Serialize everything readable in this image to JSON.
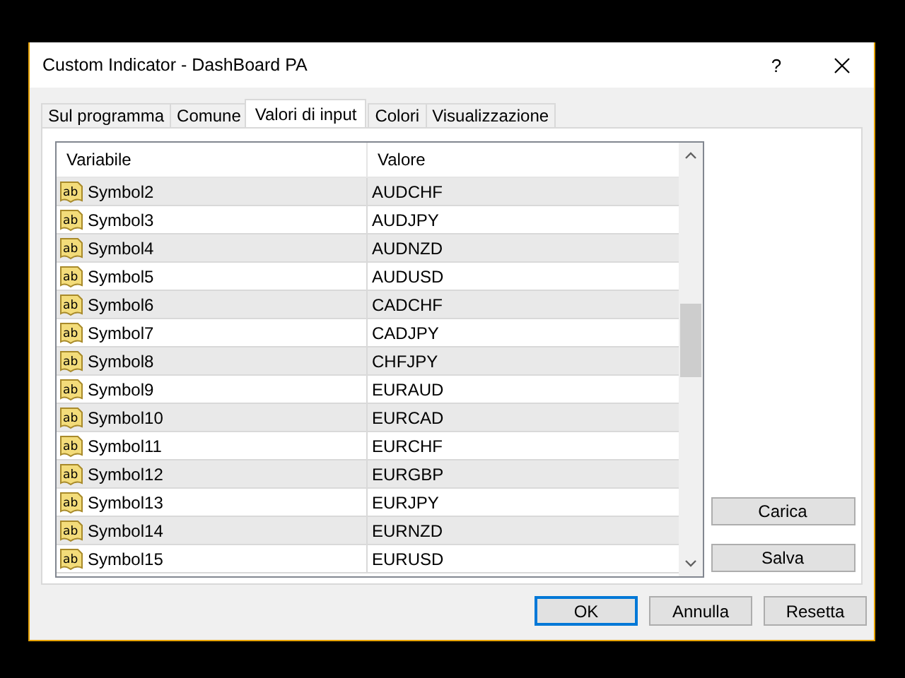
{
  "window": {
    "title": "Custom Indicator - DashBoard PA",
    "title_buttons": [
      "?"
    ]
  },
  "tabs": [
    {
      "label": "Sul programma",
      "selected": false
    },
    {
      "label": "Comune",
      "selected": false
    },
    {
      "label": "Valori di input",
      "selected": true
    },
    {
      "label": "Colori",
      "selected": false
    },
    {
      "label": "Visualizzazione",
      "selected": false
    }
  ],
  "table": {
    "columns": [
      "Variabile",
      "Valore"
    ],
    "rows": [
      {
        "icon_text": "ab",
        "variable": "Symbol2",
        "value": "AUDCHF"
      },
      {
        "icon_text": "ab",
        "variable": "Symbol3",
        "value": "AUDJPY"
      },
      {
        "icon_text": "ab",
        "variable": "Symbol4",
        "value": "AUDNZD"
      },
      {
        "icon_text": "ab",
        "variable": "Symbol5",
        "value": "AUDUSD"
      },
      {
        "icon_text": "ab",
        "variable": "Symbol6",
        "value": "CADCHF"
      },
      {
        "icon_text": "ab",
        "variable": "Symbol7",
        "value": "CADJPY"
      },
      {
        "icon_text": "ab",
        "variable": "Symbol8",
        "value": "CHFJPY"
      },
      {
        "icon_text": "ab",
        "variable": "Symbol9",
        "value": "EURAUD"
      },
      {
        "icon_text": "ab",
        "variable": "Symbol10",
        "value": "EURCAD"
      },
      {
        "icon_text": "ab",
        "variable": "Symbol11",
        "value": "EURCHF"
      },
      {
        "icon_text": "ab",
        "variable": "Symbol12",
        "value": "EURGBP"
      },
      {
        "icon_text": "ab",
        "variable": "Symbol13",
        "value": "EURJPY"
      },
      {
        "icon_text": "ab",
        "variable": "Symbol14",
        "value": "EURNZD"
      },
      {
        "icon_text": "ab",
        "variable": "Symbol15",
        "value": "EURUSD"
      }
    ]
  },
  "side_buttons": [
    "Carica",
    "Salva"
  ],
  "buttons": [
    {
      "label": "OK",
      "default": true
    },
    {
      "label": "Annulla",
      "default": false
    },
    {
      "label": "Resetta",
      "default": false
    }
  ]
}
